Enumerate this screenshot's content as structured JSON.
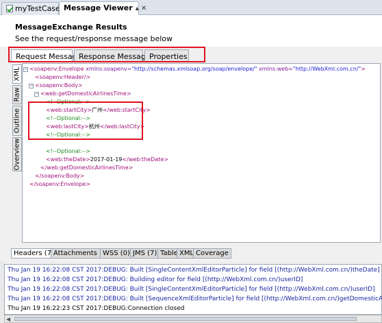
{
  "tabs": {
    "tab1": "myTestCase",
    "tab2": "Message Viewer",
    "tab2_buttons": "▴ ✕"
  },
  "header": {
    "title": "MessageExchange Results",
    "subtitle": "See the request/response message below"
  },
  "message_tabs": [
    "Request Message",
    "Response Message",
    "Properties"
  ],
  "side_tabs": [
    "XML",
    "Raw",
    "Outline",
    "Overview"
  ],
  "xml_lines": [
    [
      "<",
      "soapenv:Envelope",
      " xmlns:soapenv=",
      "\"http://schemas.xmlsoap.org/soap/envelope/\"",
      " xmlns:web=",
      "\"http://WebXml.com.cn/\"",
      ">"
    ],
    [
      "<",
      "soapenv:Header/",
      ">"
    ],
    [
      "<",
      "soapenv:Body",
      ">"
    ],
    [
      "<",
      "web:getDomesticAirlinesTime",
      ">"
    ],
    [
      "<!--Optional:-->"
    ],
    [
      "<",
      "web:startCity",
      ">",
      "广州",
      "</",
      "web:startCity",
      ">"
    ],
    [
      "<!--Optional:-->"
    ],
    [
      "<",
      "web:lastCity",
      ">",
      "杭州",
      "</",
      "web:lastCity",
      ">"
    ],
    [
      "<!--Optional:-->"
    ],
    [
      "<!--Optional:-->"
    ],
    [
      "<",
      "web:theDate",
      ">",
      "2017-01-19",
      "</",
      "web:theDate",
      ">"
    ],
    [
      "</",
      "web:getDomesticAirlinesTime",
      ">"
    ],
    [
      "</",
      "soapenv:Body",
      ">"
    ],
    [
      "</",
      "soapenv:Envelope",
      ">"
    ]
  ],
  "bottom_tabs": [
    "Headers (7)",
    "Attachments (0)",
    "WSS (0)",
    "JMS (7)",
    "Table",
    "XML",
    "Coverage"
  ],
  "log_lines": [
    "Thu Jan 19 16:22:08 CST 2017:DEBUG:  Built [SingleContentXmlEditorParticle] for field [(http://WebXml.com.cn/)theDate]",
    "Thu Jan 19 16:22:08 CST 2017:DEBUG:  Building editor for field [(http://WebXml.com.cn/)userID]",
    "Thu Jan 19 16:22:08 CST 2017:DEBUG:  Built [SingleContentXmlEditorParticle] for field [(http://WebXml.com.cn/)userID]",
    "Thu Jan 19 16:22:08 CST 2017:DEBUG: Built [SequenceXmlEditorParticle] for field [(http://WebXml.com.cn/)getDomesticAirlin",
    "Thu Jan 19 16:22:23 CST 2017:DEBUG:Connection closed"
  ],
  "colors": {
    "accent_red": "#e0121e",
    "xml_tag": "#a0107a",
    "xml_value": "#1d1dd0",
    "xml_comment": "#1e8a1e",
    "log_text": "#1828a0"
  }
}
